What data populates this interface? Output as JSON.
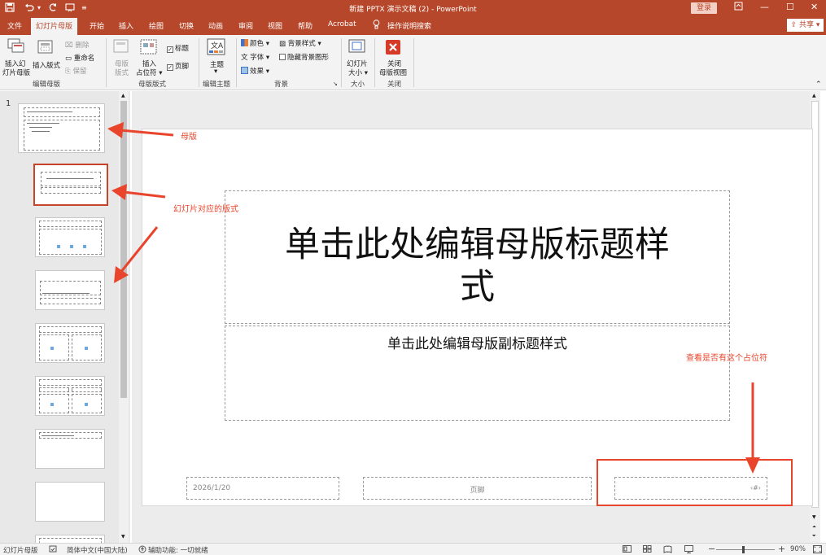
{
  "titlebar": {
    "title": "新建 PPTX 演示文稿 (2)  -  PowerPoint",
    "login": "登录",
    "win_minimize": "—",
    "win_restore": "❐",
    "win_maximize": "☐",
    "win_close": "✕"
  },
  "tabs": {
    "file": "文件",
    "slide_master": "幻灯片母版",
    "home": "开始",
    "insert": "插入",
    "draw": "绘图",
    "transitions": "切换",
    "animations": "动画",
    "review": "审阅",
    "view": "视图",
    "help": "帮助",
    "acrobat": "Acrobat",
    "tell_me": "操作说明搜索",
    "share": "共享"
  },
  "ribbon": {
    "insert_slide_master_1": "插入幻",
    "insert_slide_master_2": "灯片母版",
    "insert_layout": "插入版式",
    "delete": "删除",
    "rename": "重命名",
    "preserve": "保留",
    "group_edit_master": "编辑母版",
    "master_layout_1": "母版",
    "master_layout_2": "版式",
    "insert_placeholder_1": "插入",
    "insert_placeholder_2": "占位符",
    "title_cb": "标题",
    "footer_cb": "页脚",
    "group_master_layout": "母版版式",
    "themes": "主题",
    "group_edit_theme": "编辑主题",
    "colors": "颜色",
    "fonts": "字体",
    "effects": "效果",
    "background_styles": "背景样式",
    "hide_background": "隐藏背景图形",
    "group_background": "背景",
    "slide_size_1": "幻灯片",
    "slide_size_2": "大小",
    "group_size": "大小",
    "close_master_1": "关闭",
    "close_master_2": "母版视图",
    "group_close": "关闭"
  },
  "thumbnails": {
    "first_number": "1"
  },
  "slide": {
    "title_line1": "单击此处编辑母版标题样",
    "title_line2": "式",
    "subtitle": "单击此处编辑母版副标题样式",
    "date": "2026/1/20",
    "footer": "页脚",
    "slide_number": "‹#›"
  },
  "annotations": {
    "master": "母版",
    "layout": "幻灯片对应的版式",
    "check_placeholder": "查看是否有这个占位符",
    "color": "#e8452c"
  },
  "statusbar": {
    "view_name": "幻灯片母版",
    "language": "简体中文(中国大陆)",
    "accessibility": "辅助功能: 一切就绪",
    "zoom_minus": "−",
    "zoom_plus": "+",
    "zoom": "90%"
  },
  "colors": {
    "brand": "#b7472a",
    "ribbon_bg": "#f3f3f3"
  }
}
